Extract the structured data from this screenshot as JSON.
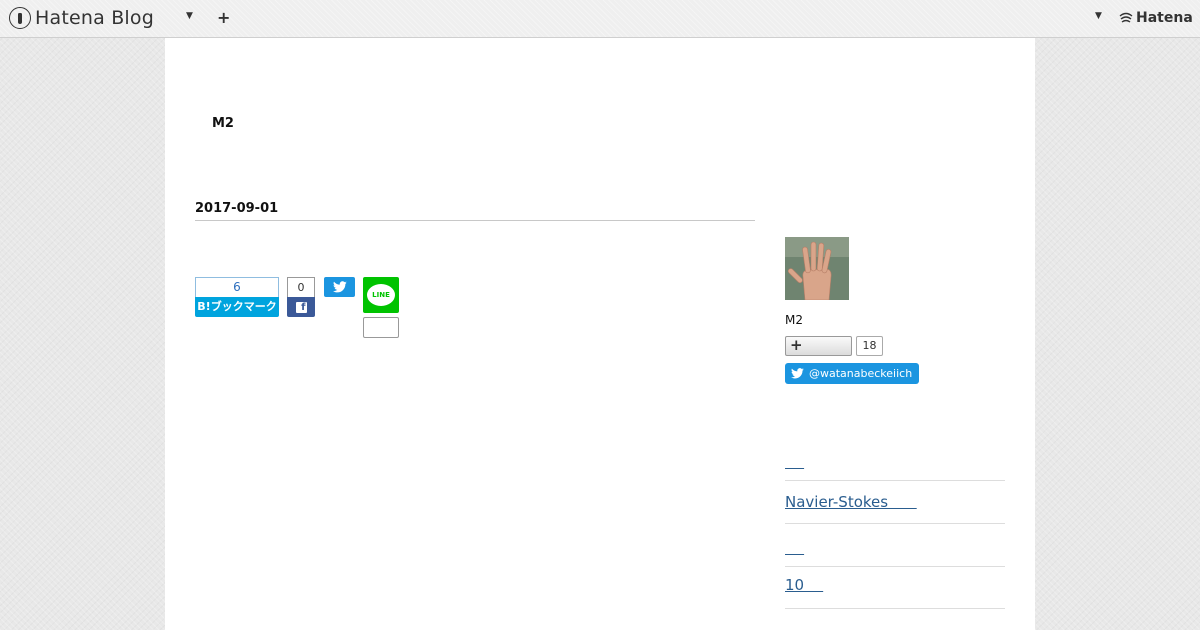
{
  "topbar": {
    "brand": "Hatena Blog",
    "hatena_label": "Hatena"
  },
  "blog": {
    "title": "M2"
  },
  "entry": {
    "date": "2017-09-01"
  },
  "share": {
    "hatena_bookmark_count": "6",
    "hatena_bookmark_label": "B!ブックマーク",
    "facebook_count": "0",
    "line_label": "LINE"
  },
  "sidebar": {
    "profile_name": "M2",
    "follower_count": "18",
    "twitter_handle": "@watanabeckeiich",
    "links": [
      {
        "label": "    "
      },
      {
        "label": " Navier-Stokes      "
      },
      {
        "label": "    "
      },
      {
        "label": "10    "
      }
    ]
  },
  "colors": {
    "hatena_blue": "#00a4de",
    "facebook_blue": "#3b5998",
    "twitter_blue": "#1b95e0",
    "line_green": "#00c300",
    "link": "#2a5d8f"
  },
  "icons": [
    "hatena-blog-logo-icon",
    "caret-down-icon",
    "plus-icon",
    "hatena-logo-icon",
    "facebook-icon",
    "twitter-icon",
    "line-icon",
    "avatar-hand-photo"
  ]
}
